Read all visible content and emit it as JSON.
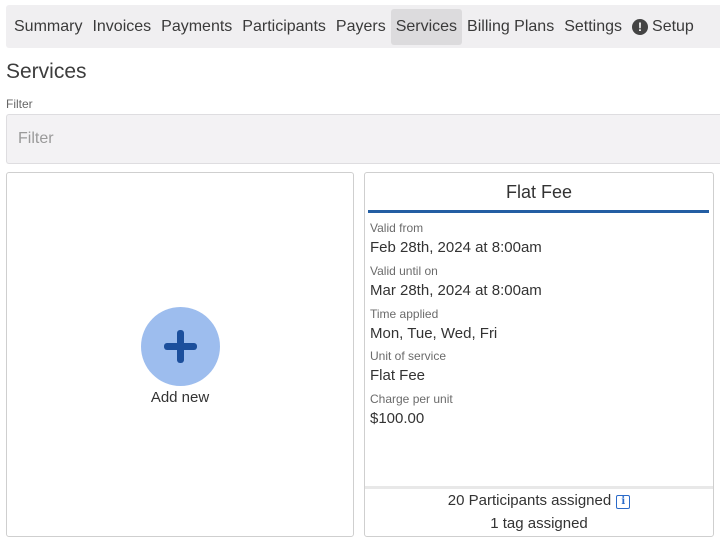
{
  "nav": {
    "items": [
      {
        "label": "Summary"
      },
      {
        "label": "Invoices"
      },
      {
        "label": "Payments"
      },
      {
        "label": "Participants"
      },
      {
        "label": "Payers"
      },
      {
        "label": "Services"
      },
      {
        "label": "Billing Plans"
      },
      {
        "label": "Settings"
      },
      {
        "label": "Setup"
      }
    ],
    "active": "Services",
    "setup_icon": "!"
  },
  "page": {
    "title": "Services"
  },
  "filter": {
    "label": "Filter",
    "placeholder": "Filter",
    "value": ""
  },
  "add_card": {
    "label": "Add new",
    "icon": "plus-icon",
    "color": "#9dbdee"
  },
  "service": {
    "name": "Flat Fee",
    "accent": "#235ea3",
    "fields": [
      {
        "label": "Valid from",
        "value": "Feb 28th, 2024 at 8:00am"
      },
      {
        "label": "Valid until on",
        "value": "Mar 28th, 2024 at 8:00am"
      },
      {
        "label": "Time applied",
        "value": "Mon, Tue, Wed, Fri"
      },
      {
        "label": "Unit of service",
        "value": "Flat Fee"
      },
      {
        "label": "Charge per unit",
        "value": "$100.00"
      }
    ],
    "participants_assigned": "20 Participants assigned",
    "info_icon": "i",
    "tags_assigned": "1 tag assigned"
  }
}
